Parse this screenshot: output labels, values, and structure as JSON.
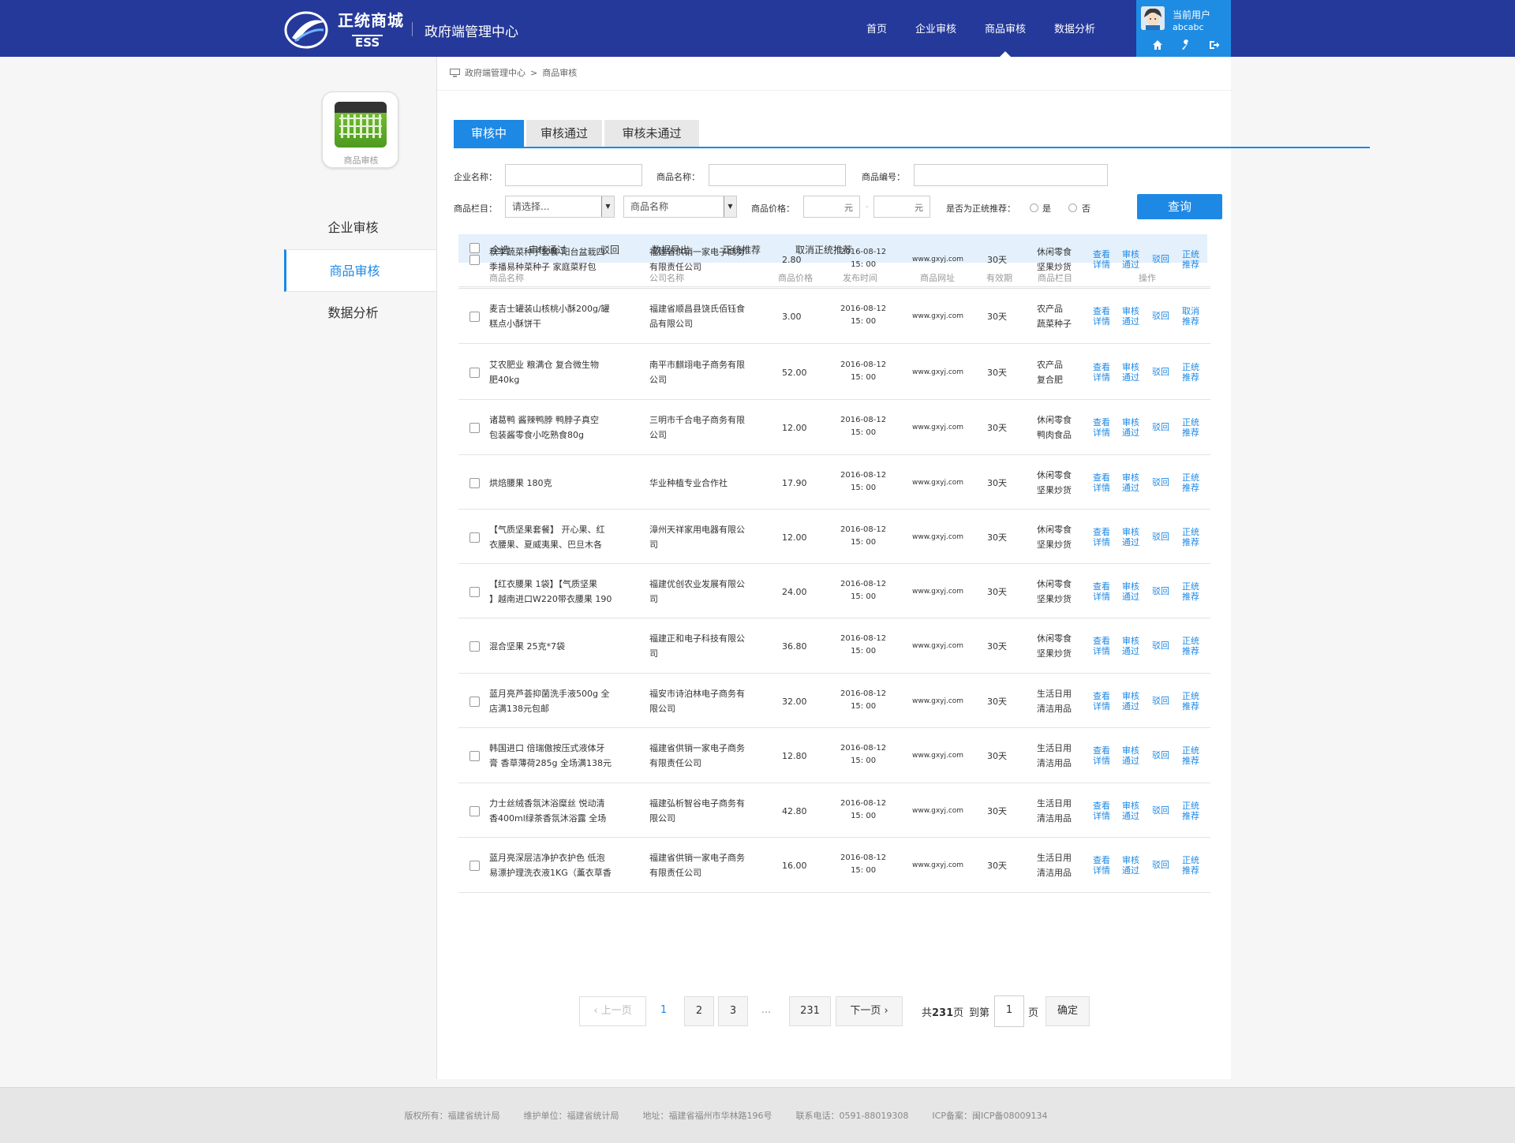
{
  "header": {
    "logo_text": "正统商城",
    "logo_sub": "ESS",
    "title": "政府端管理中心",
    "nav": [
      "首页",
      "企业审核",
      "商品审核",
      "数据分析"
    ],
    "active_nav": 2,
    "user_label": "当前用户",
    "user_name": "abcabc"
  },
  "sidebar": {
    "logo_label": "商品审核",
    "items": [
      "企业审核",
      "商品审核",
      "数据分析"
    ],
    "active": 1
  },
  "breadcrumb": {
    "root": "政府端管理中心",
    "sep": ">",
    "current": "商品审核"
  },
  "tabs": [
    "审核中",
    "审核通过",
    "审核未通过"
  ],
  "filters": {
    "company_label": "企业名称：",
    "product_label": "商品名称：",
    "code_label": "商品编号：",
    "category_label": "商品栏目：",
    "category_value": "请选择...",
    "subcategory_value": "商品名称",
    "price_label": "商品价格：",
    "price_unit": "元",
    "price_sep": "-",
    "recommend_label": "是否为正统推荐：",
    "yes": "是",
    "no": "否",
    "query": "查询"
  },
  "toolbar": [
    "全选",
    "审核通过",
    "驳回",
    "数据导出",
    "正统推荐",
    "取消正统推荐"
  ],
  "columns": [
    "商品名称",
    "公司名称",
    "商品价格",
    "发布时间",
    "商品网址",
    "有效期",
    "商品栏目",
    "操作"
  ],
  "rows": [
    {
      "name1": "秋季蔬菜种子套餐 阳台盆栽四",
      "name2": "季播易种菜种子 家庭菜籽包",
      "co1": "福建省供销一家电子商务",
      "co2": "有限责任公司",
      "price": "2.80",
      "date": "2016-08-12",
      "time": "15: 00",
      "url": "www.gxyj.com",
      "valid": "30天",
      "cat1": "休闲零食",
      "cat2": "坚果炒货",
      "rec1": "正统",
      "rec2": "推荐"
    },
    {
      "name1": "麦吉士罐装山核桃小酥200g/罐",
      "name2": "糕点小酥饼干",
      "co1": "福建省顺昌县饶氏佰钰食",
      "co2": "品有限公司",
      "price": "3.00",
      "date": "2016-08-12",
      "time": "15: 00",
      "url": "www.gxyj.com",
      "valid": "30天",
      "cat1": "农产品",
      "cat2": "蔬菜种子",
      "rec1": "取消",
      "rec2": "推荐"
    },
    {
      "name1": "艾农肥业 粮满仓 复合微生物",
      "name2": "肥40kg",
      "co1": "南平市麒翊电子商务有限",
      "co2": "公司",
      "price": "52.00",
      "date": "2016-08-12",
      "time": "15: 00",
      "url": "www.gxyj.com",
      "valid": "30天",
      "cat1": "农产品",
      "cat2": "复合肥",
      "rec1": "正统",
      "rec2": "推荐"
    },
    {
      "name1": "诸葛鸭 酱辣鸭脖 鸭脖子真空",
      "name2": "包装酱零食小吃熟食80g",
      "co1": "三明市千合电子商务有限",
      "co2": "公司",
      "price": "12.00",
      "date": "2016-08-12",
      "time": "15: 00",
      "url": "www.gxyj.com",
      "valid": "30天",
      "cat1": "休闲零食",
      "cat2": "鸭肉食品",
      "rec1": "正统",
      "rec2": "推荐"
    },
    {
      "name1": "烘焙腰果 180克",
      "name2": "",
      "co1": "华业种植专业合作社",
      "co2": "",
      "price": "17.90",
      "date": "2016-08-12",
      "time": "15: 00",
      "url": "www.gxyj.com",
      "valid": "30天",
      "cat1": "休闲零食",
      "cat2": "坚果炒货",
      "rec1": "正统",
      "rec2": "推荐"
    },
    {
      "name1": "【气质坚果套餐】 开心果、红",
      "name2": "衣腰果、夏威夷果、巴旦木各",
      "co1": "漳州天祥家用电器有限公",
      "co2": "司",
      "price": "12.00",
      "date": "2016-08-12",
      "time": "15: 00",
      "url": "www.gxyj.com",
      "valid": "30天",
      "cat1": "休闲零食",
      "cat2": "坚果炒货",
      "rec1": "正统",
      "rec2": "推荐"
    },
    {
      "name1": "【红衣腰果 1袋】【气质坚果",
      "name2": "】越南进口W220带衣腰果 190",
      "co1": "福建优创农业发展有限公",
      "co2": "司",
      "price": "24.00",
      "date": "2016-08-12",
      "time": "15: 00",
      "url": "www.gxyj.com",
      "valid": "30天",
      "cat1": "休闲零食",
      "cat2": "坚果炒货",
      "rec1": "正统",
      "rec2": "推荐"
    },
    {
      "name1": "混合坚果 25克*7袋",
      "name2": "",
      "co1": "福建正和电子科技有限公",
      "co2": "司",
      "price": "36.80",
      "date": "2016-08-12",
      "time": "15: 00",
      "url": "www.gxyj.com",
      "valid": "30天",
      "cat1": "休闲零食",
      "cat2": "坚果炒货",
      "rec1": "正统",
      "rec2": "推荐"
    },
    {
      "name1": "蓝月亮芦荟抑菌洗手液500g 全",
      "name2": "店满138元包邮",
      "co1": "福安市诗泊林电子商务有",
      "co2": "限公司",
      "price": "32.00",
      "date": "2016-08-12",
      "time": "15: 00",
      "url": "www.gxyj.com",
      "valid": "30天",
      "cat1": "生活日用",
      "cat2": "清洁用品",
      "rec1": "正统",
      "rec2": "推荐"
    },
    {
      "name1": "韩国进口 倍瑞傲按压式液体牙",
      "name2": "膏 香草薄荷285g 全场满138元",
      "co1": "福建省供销一家电子商务",
      "co2": "有限责任公司",
      "price": "12.80",
      "date": "2016-08-12",
      "time": "15: 00",
      "url": "www.gxyj.com",
      "valid": "30天",
      "cat1": "生活日用",
      "cat2": "清洁用品",
      "rec1": "正统",
      "rec2": "推荐"
    },
    {
      "name1": "力士丝绒香氛沐浴糜丝 悦动清",
      "name2": "香400ml绿茶香氛沐浴露 全场",
      "co1": "福建弘析智谷电子商务有",
      "co2": "限公司",
      "price": "42.80",
      "date": "2016-08-12",
      "time": "15: 00",
      "url": "www.gxyj.com",
      "valid": "30天",
      "cat1": "生活日用",
      "cat2": "清洁用品",
      "rec1": "正统",
      "rec2": "推荐"
    },
    {
      "name1": "蓝月亮深层洁净护衣护色 低泡",
      "name2": "易漂护理洗衣液1KG（薰衣草香",
      "co1": "福建省供销一家电子商务",
      "co2": "有限责任公司",
      "price": "16.00",
      "date": "2016-08-12",
      "time": "15: 00",
      "url": "www.gxyj.com",
      "valid": "30天",
      "cat1": "生活日用",
      "cat2": "清洁用品",
      "rec1": "正统",
      "rec2": "推荐"
    }
  ],
  "actions": {
    "view1": "查看",
    "view2": "详情",
    "approve1": "审核",
    "approve2": "通过",
    "reject": "驳回"
  },
  "pager": {
    "prev": "上一页",
    "next": "下一页",
    "pages": [
      "1",
      "2",
      "3",
      "...",
      "231"
    ],
    "total_prefix": "共",
    "total": "231",
    "total_suffix": "页",
    "goto": "到第",
    "goto_value": "1",
    "goto_suffix": "页",
    "confirm": "确定"
  },
  "footer": [
    "版权所有：福建省统计局",
    "维护单位：福建省统计局",
    "地址：福建省福州市华林路196号",
    "联系电话：0591-88019308",
    "ICP备案：闽ICP备08009134"
  ],
  "colors": {
    "header": "#25399a",
    "accent": "#1e88e5",
    "user_box": "#1f8ce3"
  }
}
